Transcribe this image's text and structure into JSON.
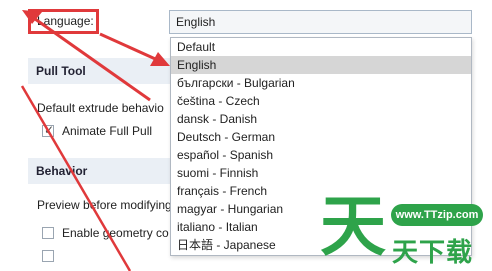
{
  "language": {
    "label": "Language:",
    "selected_value": "English",
    "options": [
      "Default",
      "English",
      "български - Bulgarian",
      "čeština - Czech",
      "dansk - Danish",
      "Deutsch - German",
      "español - Spanish",
      "suomi - Finnish",
      "français - French",
      "magyar - Hungarian",
      "italiano - Italian",
      "日本語 - Japanese"
    ],
    "highlighted_option": "English"
  },
  "pull_tool": {
    "heading": "Pull Tool",
    "default_extrude_label": "Default extrude behavio",
    "animate_full_pull_label": "Animate Full Pull",
    "animate_full_pull_checked": true
  },
  "behavior": {
    "heading": "Behavior",
    "preview_label": "Preview before modifying",
    "enable_geometry_label": "Enable geometry co",
    "enable_geometry_checked": false
  },
  "watermark": {
    "url": "www.TTzip.com",
    "big_char": "天",
    "chars": "天下载"
  },
  "colors": {
    "annotation_red": "#e0393b",
    "watermark_green": "#2ea34a",
    "section_bg": "#eaeff5",
    "selected_option_bg": "#d6d6d6"
  }
}
